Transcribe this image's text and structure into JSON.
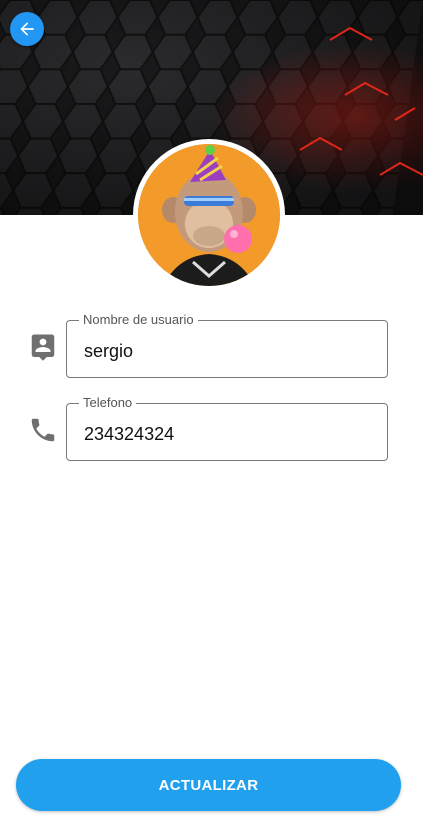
{
  "header": {
    "back_icon": "arrow-back-icon",
    "accent_color": "#2196f3",
    "background_description_colors": [
      "#1a1a1c",
      "#3a3a3c",
      "#e01818"
    ]
  },
  "profile": {
    "avatar_icon": "profile-avatar"
  },
  "form": {
    "username": {
      "icon": "contact-card-icon",
      "label": "Nombre de usuario",
      "value": "sergio"
    },
    "phone": {
      "icon": "phone-icon",
      "label": "Telefono",
      "value": "234324324"
    }
  },
  "actions": {
    "update_label": "ACTUALIZAR",
    "button_color": "#21a0ee"
  }
}
